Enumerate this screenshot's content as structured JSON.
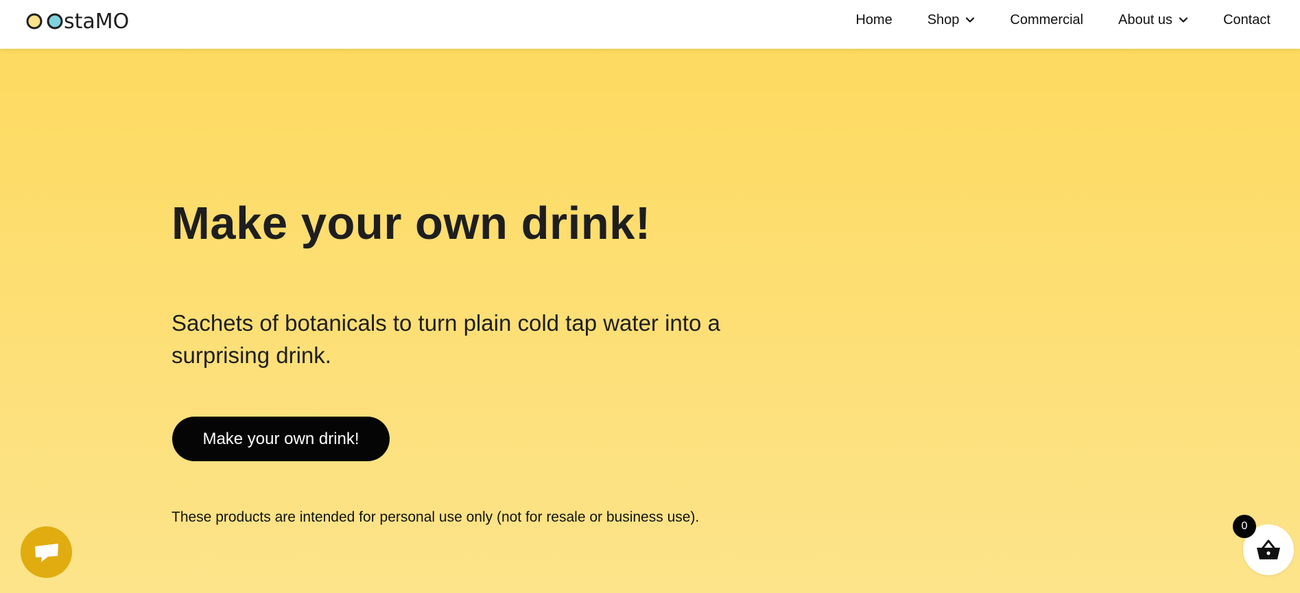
{
  "header": {
    "logo_text": "oostaMO",
    "nav": [
      {
        "label": "Home",
        "has_dropdown": false
      },
      {
        "label": "Shop",
        "has_dropdown": true
      },
      {
        "label": "Commercial",
        "has_dropdown": false
      },
      {
        "label": "About us",
        "has_dropdown": true
      },
      {
        "label": "Contact",
        "has_dropdown": false
      }
    ]
  },
  "hero": {
    "title": "Make your own drink!",
    "subtitle": "Sachets of botanicals to turn plain cold tap water into a surprising drink.",
    "cta_label": "Make your own drink!",
    "disclaimer": "These products are intended for personal use only (not for resale or business use)."
  },
  "floating": {
    "chat_icon": "chat-bubble-icon",
    "cart_icon": "basket-icon",
    "cart_count": "0"
  },
  "colors": {
    "background_top": "#fdd95c",
    "background_bottom": "#fde48b",
    "header_bg": "#ffffff",
    "cta_bg": "#050505",
    "cta_text": "#ffffff",
    "chat_button": "#e0ac0f",
    "logo_dot_yellow": "#fde28a",
    "logo_dot_teal": "#7fd3e0"
  }
}
